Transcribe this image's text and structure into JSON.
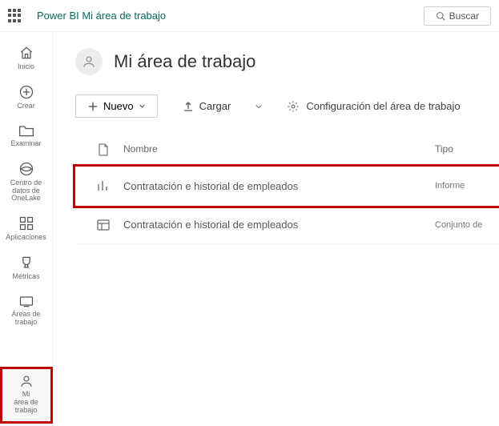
{
  "topbar": {
    "brand": "Power BI Mi área de trabajo",
    "search_label": "Buscar"
  },
  "nav": {
    "home": "Inicio",
    "create": "Crear",
    "browse": "Examinar",
    "onelake": "Centro de datos de OneLake",
    "apps": "Aplicaciones",
    "metrics": "Métricas",
    "workspaces": "Áreas de trabajo",
    "my_workspace_line1": "Mi",
    "my_workspace_line2": "área de trabajo"
  },
  "workspace": {
    "title": "Mi área de trabajo"
  },
  "toolbar": {
    "new_label": "Nuevo",
    "upload_label": "Cargar",
    "settings_label": "Configuración del área de trabajo"
  },
  "table": {
    "headers": {
      "name": "Nombre",
      "type": "Tipo"
    },
    "rows": [
      {
        "name": "Contratación e historial de empleados",
        "type": "Informe",
        "icon": "report"
      },
      {
        "name": "Contratación e historial de empleados",
        "type": "Conjunto de",
        "icon": "dataset"
      }
    ]
  }
}
